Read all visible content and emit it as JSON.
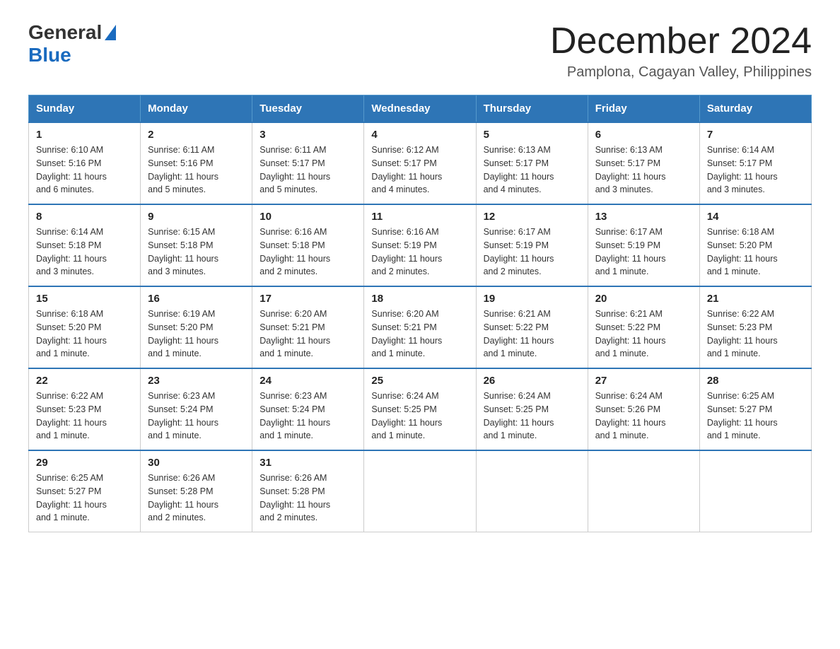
{
  "header": {
    "logo_general": "General",
    "logo_blue": "Blue",
    "month_title": "December 2024",
    "subtitle": "Pamplona, Cagayan Valley, Philippines"
  },
  "days_of_week": [
    "Sunday",
    "Monday",
    "Tuesday",
    "Wednesday",
    "Thursday",
    "Friday",
    "Saturday"
  ],
  "weeks": [
    [
      {
        "day": "1",
        "sunrise": "6:10 AM",
        "sunset": "5:16 PM",
        "daylight": "11 hours and 6 minutes."
      },
      {
        "day": "2",
        "sunrise": "6:11 AM",
        "sunset": "5:16 PM",
        "daylight": "11 hours and 5 minutes."
      },
      {
        "day": "3",
        "sunrise": "6:11 AM",
        "sunset": "5:17 PM",
        "daylight": "11 hours and 5 minutes."
      },
      {
        "day": "4",
        "sunrise": "6:12 AM",
        "sunset": "5:17 PM",
        "daylight": "11 hours and 4 minutes."
      },
      {
        "day": "5",
        "sunrise": "6:13 AM",
        "sunset": "5:17 PM",
        "daylight": "11 hours and 4 minutes."
      },
      {
        "day": "6",
        "sunrise": "6:13 AM",
        "sunset": "5:17 PM",
        "daylight": "11 hours and 3 minutes."
      },
      {
        "day": "7",
        "sunrise": "6:14 AM",
        "sunset": "5:17 PM",
        "daylight": "11 hours and 3 minutes."
      }
    ],
    [
      {
        "day": "8",
        "sunrise": "6:14 AM",
        "sunset": "5:18 PM",
        "daylight": "11 hours and 3 minutes."
      },
      {
        "day": "9",
        "sunrise": "6:15 AM",
        "sunset": "5:18 PM",
        "daylight": "11 hours and 3 minutes."
      },
      {
        "day": "10",
        "sunrise": "6:16 AM",
        "sunset": "5:18 PM",
        "daylight": "11 hours and 2 minutes."
      },
      {
        "day": "11",
        "sunrise": "6:16 AM",
        "sunset": "5:19 PM",
        "daylight": "11 hours and 2 minutes."
      },
      {
        "day": "12",
        "sunrise": "6:17 AM",
        "sunset": "5:19 PM",
        "daylight": "11 hours and 2 minutes."
      },
      {
        "day": "13",
        "sunrise": "6:17 AM",
        "sunset": "5:19 PM",
        "daylight": "11 hours and 1 minute."
      },
      {
        "day": "14",
        "sunrise": "6:18 AM",
        "sunset": "5:20 PM",
        "daylight": "11 hours and 1 minute."
      }
    ],
    [
      {
        "day": "15",
        "sunrise": "6:18 AM",
        "sunset": "5:20 PM",
        "daylight": "11 hours and 1 minute."
      },
      {
        "day": "16",
        "sunrise": "6:19 AM",
        "sunset": "5:20 PM",
        "daylight": "11 hours and 1 minute."
      },
      {
        "day": "17",
        "sunrise": "6:20 AM",
        "sunset": "5:21 PM",
        "daylight": "11 hours and 1 minute."
      },
      {
        "day": "18",
        "sunrise": "6:20 AM",
        "sunset": "5:21 PM",
        "daylight": "11 hours and 1 minute."
      },
      {
        "day": "19",
        "sunrise": "6:21 AM",
        "sunset": "5:22 PM",
        "daylight": "11 hours and 1 minute."
      },
      {
        "day": "20",
        "sunrise": "6:21 AM",
        "sunset": "5:22 PM",
        "daylight": "11 hours and 1 minute."
      },
      {
        "day": "21",
        "sunrise": "6:22 AM",
        "sunset": "5:23 PM",
        "daylight": "11 hours and 1 minute."
      }
    ],
    [
      {
        "day": "22",
        "sunrise": "6:22 AM",
        "sunset": "5:23 PM",
        "daylight": "11 hours and 1 minute."
      },
      {
        "day": "23",
        "sunrise": "6:23 AM",
        "sunset": "5:24 PM",
        "daylight": "11 hours and 1 minute."
      },
      {
        "day": "24",
        "sunrise": "6:23 AM",
        "sunset": "5:24 PM",
        "daylight": "11 hours and 1 minute."
      },
      {
        "day": "25",
        "sunrise": "6:24 AM",
        "sunset": "5:25 PM",
        "daylight": "11 hours and 1 minute."
      },
      {
        "day": "26",
        "sunrise": "6:24 AM",
        "sunset": "5:25 PM",
        "daylight": "11 hours and 1 minute."
      },
      {
        "day": "27",
        "sunrise": "6:24 AM",
        "sunset": "5:26 PM",
        "daylight": "11 hours and 1 minute."
      },
      {
        "day": "28",
        "sunrise": "6:25 AM",
        "sunset": "5:27 PM",
        "daylight": "11 hours and 1 minute."
      }
    ],
    [
      {
        "day": "29",
        "sunrise": "6:25 AM",
        "sunset": "5:27 PM",
        "daylight": "11 hours and 1 minute."
      },
      {
        "day": "30",
        "sunrise": "6:26 AM",
        "sunset": "5:28 PM",
        "daylight": "11 hours and 2 minutes."
      },
      {
        "day": "31",
        "sunrise": "6:26 AM",
        "sunset": "5:28 PM",
        "daylight": "11 hours and 2 minutes."
      },
      null,
      null,
      null,
      null
    ]
  ],
  "labels": {
    "sunrise": "Sunrise:",
    "sunset": "Sunset:",
    "daylight": "Daylight:"
  }
}
